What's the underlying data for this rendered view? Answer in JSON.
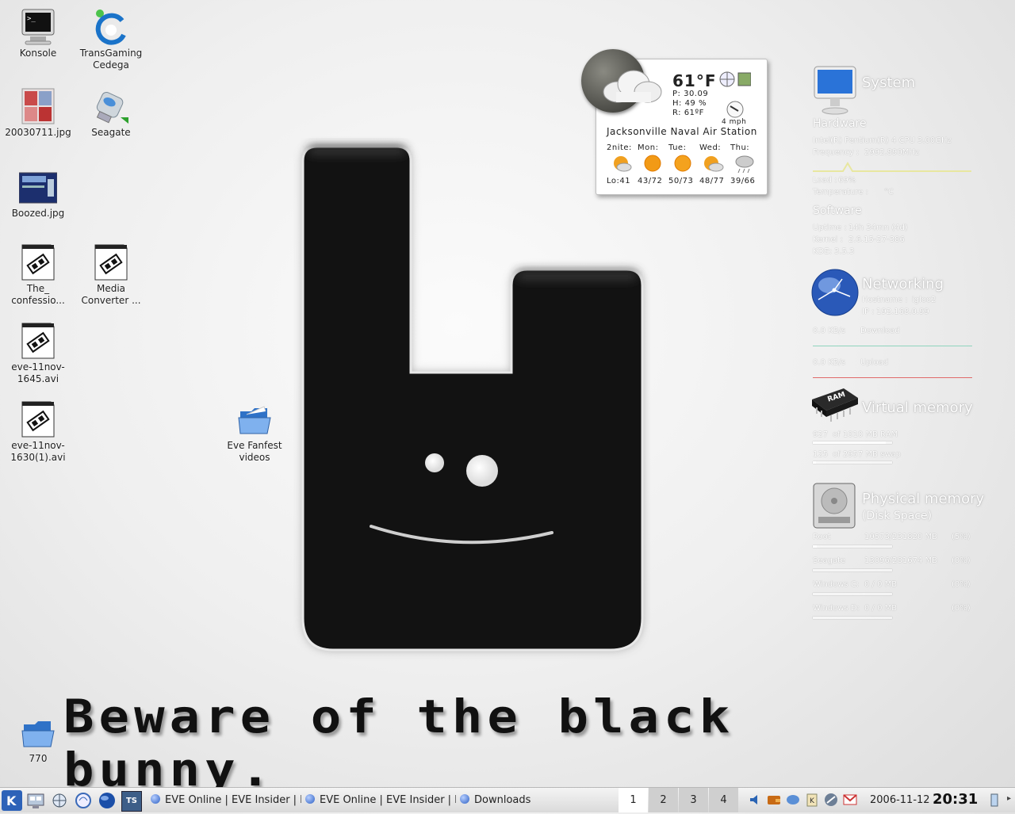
{
  "desktop": {
    "icons": [
      {
        "label": "Konsole",
        "icon": "monitor-terminal-icon"
      },
      {
        "label": "TransGaming Cedega",
        "icon": "cedega-icon"
      },
      {
        "label": "20030711.jpg",
        "icon": "image-file-icon"
      },
      {
        "label": "Seagate",
        "icon": "usb-drive-icon"
      },
      {
        "label": "Boozed.jpg",
        "icon": "image-file-icon"
      },
      {
        "label": "The_ confessio...",
        "icon": "video-file-icon"
      },
      {
        "label": "Media Converter ...",
        "icon": "video-file-icon"
      },
      {
        "label": "eve-11nov-1645.avi",
        "icon": "video-file-icon"
      },
      {
        "label": "eve-11nov-1630(1).avi",
        "icon": "video-file-icon"
      },
      {
        "label": "Eve Fanfest videos",
        "icon": "folder-icon"
      },
      {
        "label": "770",
        "icon": "folder-icon"
      }
    ],
    "wallpaper_text": "Beware of the black bunny."
  },
  "weather": {
    "temp": "61°F",
    "pressure": "P: 30.09",
    "humidity": "H: 49 %",
    "realfeel": "R: 61ºF",
    "wind": "4 mph",
    "station": "Jacksonville Naval Air Station",
    "days": [
      "2nite:",
      "Mon:",
      "Tue:",
      "Wed:",
      "Thu:"
    ],
    "temps": [
      "Lo:41",
      "43/72",
      "50/73",
      "48/77",
      "39/66"
    ]
  },
  "sysmon": {
    "system": {
      "title": "System",
      "hardware_title": "Hardware",
      "cpu": "Intel(R) Pentium(R) 4 CPU 3.00GHz",
      "frequency_label": "Frequency :",
      "frequency": "2992.890MHz",
      "load_label": "Load :",
      "load": "69%",
      "temp_label": "Temperature :",
      "temp": "°C",
      "software_title": "Software",
      "uptime_label": "Uptime :",
      "uptime": "14h 34mn (4d)",
      "kernel_label": "Kernel :",
      "kernel": "2.6.15-27-386",
      "kde_label": "KDE:",
      "kde": "3.5.3"
    },
    "networking": {
      "title": "Networking",
      "hostname_label": "Hostname :",
      "hostname": "igloo2",
      "ip_label": "IP :",
      "ip": "192.168.0.99",
      "down_rate": "0.0 KB/s",
      "down_label": "Download",
      "up_rate": "0.0 KB/s",
      "up_label": "Upload"
    },
    "virtual_memory": {
      "title": "Virtual memory",
      "ram_used": "927",
      "ram_text": "of 1010 MB RAM",
      "ram_fraction": 0.92,
      "swap_used": "125",
      "swap_text": "of 2957 MB swap",
      "swap_fraction": 0.04
    },
    "physical_memory": {
      "title": "Physical memory",
      "subtitle": "(Disk Space)",
      "disks": [
        {
          "name": "Root",
          "usage": "10573/231820 MB",
          "pct": "(5%)",
          "fraction": 0.05
        },
        {
          "name": "Seagate",
          "usage": "13096/281674 MB",
          "pct": "(0%)",
          "fraction": 0.0
        },
        {
          "name": "Windows C:",
          "usage": "0      / 0 MB",
          "pct": "(0%)",
          "fraction": 0.0
        },
        {
          "name": "Windows D:",
          "usage": "0      / 0 MB",
          "pct": "(0%)",
          "fraction": 0.0
        }
      ]
    }
  },
  "taskbar": {
    "tasks": [
      "EVE Online | EVE Insider | F",
      "EVE Online | EVE Insider | F",
      "Downloads"
    ],
    "pager": [
      "1",
      "2",
      "3",
      "4"
    ],
    "active_desktop": "1",
    "date": "2006-11-12",
    "time": "20:31"
  },
  "colors": {
    "net_download": "#8fd4bd",
    "net_upload": "#e06a6a",
    "load_graph": "#e8e7a0",
    "taskbar_active": "#ffffff"
  }
}
